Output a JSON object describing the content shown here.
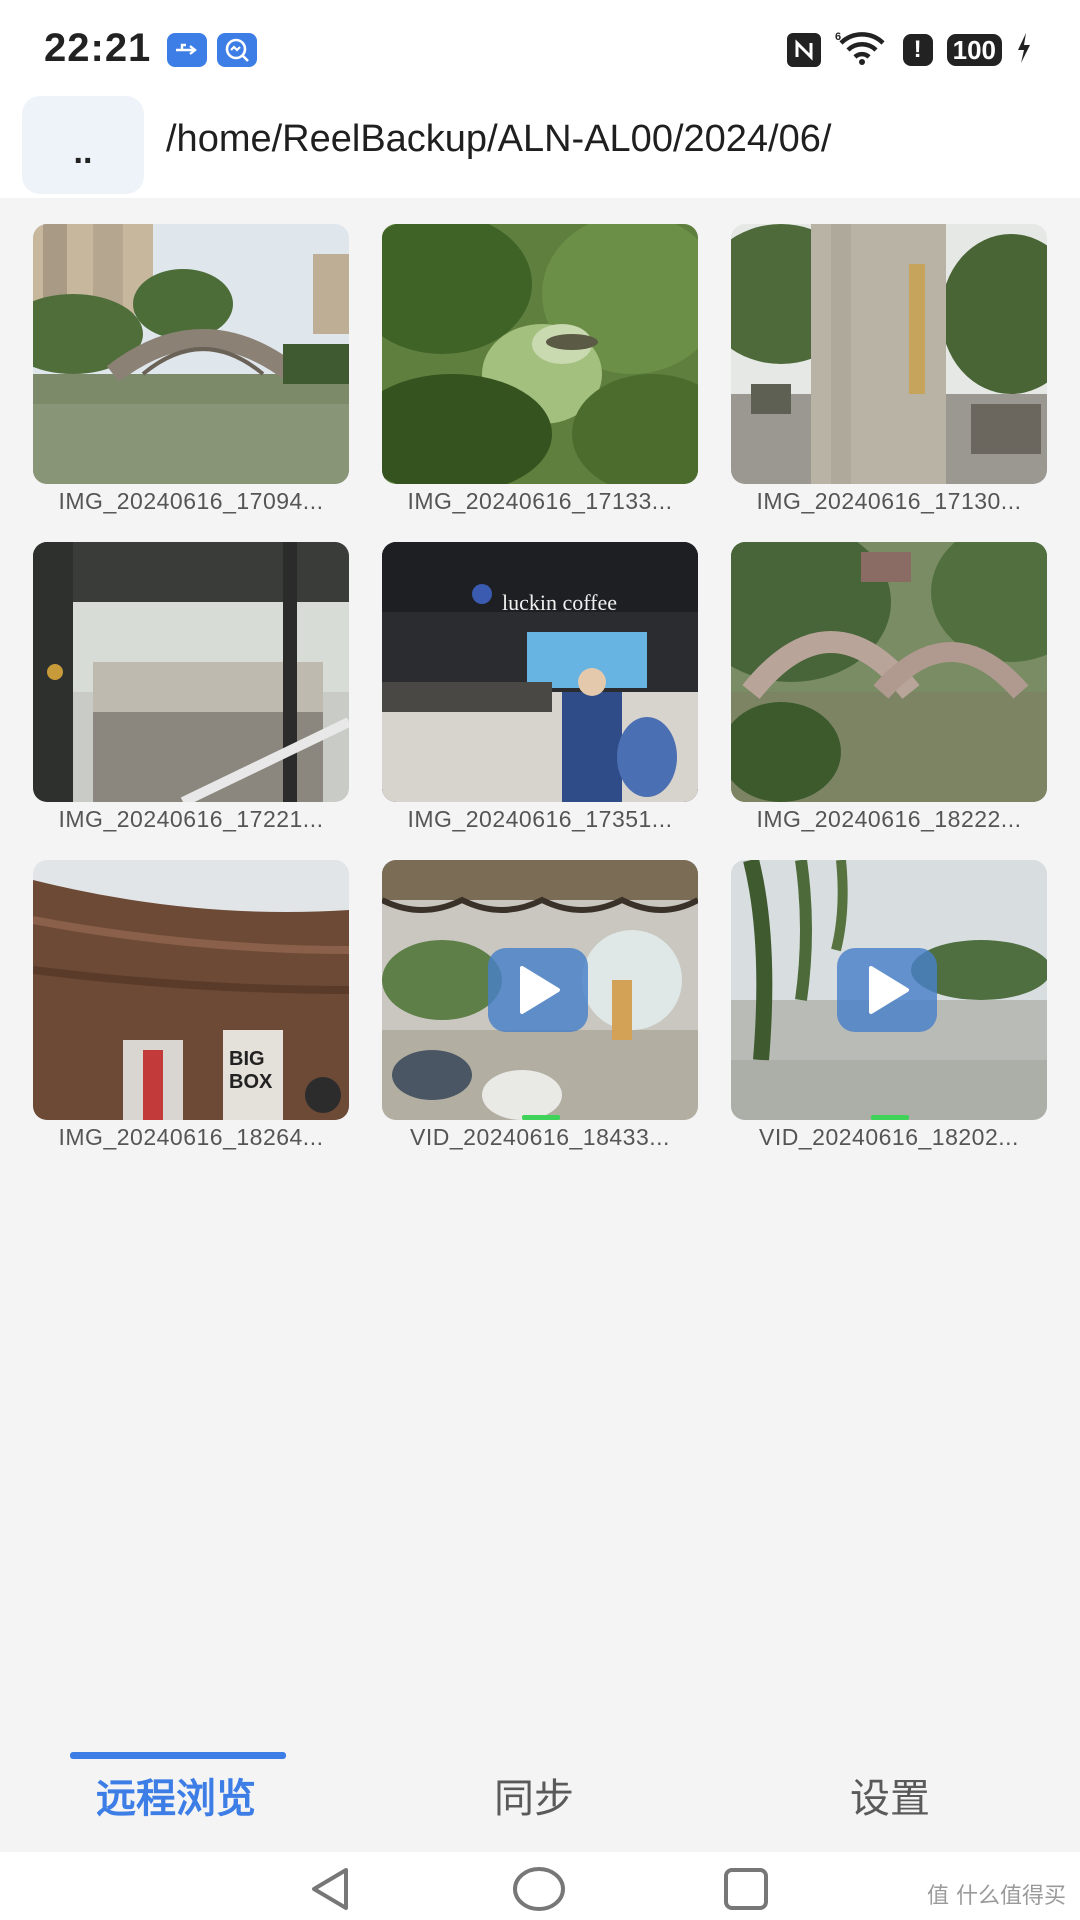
{
  "status_bar": {
    "time": "22:21",
    "battery": "100",
    "icons": [
      "usb-icon",
      "app-notification-icon",
      "nfc-icon",
      "wifi-icon",
      "alert-icon",
      "battery-icon",
      "charging-icon"
    ]
  },
  "header": {
    "up_label": "..",
    "path": "/home/ReelBackup/ALN-AL00/2024/06/"
  },
  "files": [
    {
      "name": "IMG_20240616_17094...",
      "type": "image"
    },
    {
      "name": "IMG_20240616_17133...",
      "type": "image"
    },
    {
      "name": "IMG_20240616_17130...",
      "type": "image"
    },
    {
      "name": "IMG_20240616_17221...",
      "type": "image"
    },
    {
      "name": "IMG_20240616_17351...",
      "type": "image"
    },
    {
      "name": "IMG_20240616_18222...",
      "type": "image"
    },
    {
      "name": "IMG_20240616_18264...",
      "type": "image"
    },
    {
      "name": "VID_20240616_18433...",
      "type": "video"
    },
    {
      "name": "VID_20240616_18202...",
      "type": "video"
    }
  ],
  "tabs": [
    {
      "label": "远程浏览",
      "active": true
    },
    {
      "label": "同步",
      "active": false
    },
    {
      "label": "设置",
      "active": false
    }
  ],
  "watermark": "值 什么值得买",
  "colors": {
    "accent": "#3d7de6",
    "background": "#f4f4f4"
  }
}
